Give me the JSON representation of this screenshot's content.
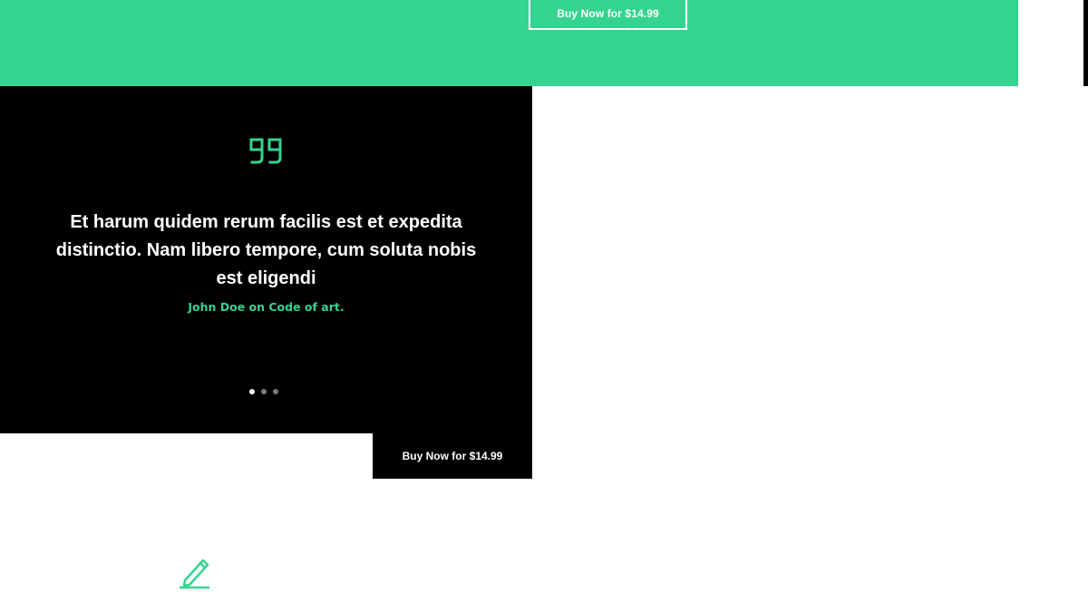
{
  "header": {
    "buy_button_label": "Buy Now for $14.99"
  },
  "testimonial": {
    "quote_icon": "quote-icon",
    "quote": "Et harum quidem rerum facilis est et expedita distinctio. Nam libero tempore, cum soluta nobis est eligendi",
    "author": "John Doe on Code of art.",
    "slides": {
      "count": 3,
      "active_index": 0
    }
  },
  "buy_block": {
    "label": "Buy Now for $14.99"
  },
  "feature": {
    "icon": "pencil-icon"
  },
  "colors": {
    "accent": "#34d48f",
    "dark": "#000000",
    "background": "#ffffff",
    "dot_inactive": "#7a7a7a"
  }
}
